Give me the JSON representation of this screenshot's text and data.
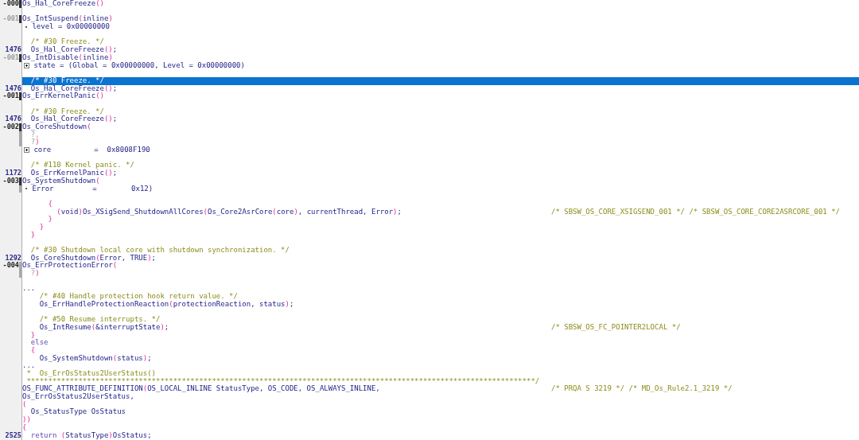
{
  "editor": {
    "lines": [
      {
        "gutter": {
          "text": "-000",
          "color": "#202020"
        },
        "marker": {
          "color": "#303030"
        },
        "selected": false,
        "segs": [
          {
            "kind": "code",
            "text": "Os_Hal_CoreFreeze"
          },
          {
            "kind": "paren",
            "text": "()"
          }
        ]
      },
      {
        "selected": false
      },
      {
        "gutter": {
          "text": "-001",
          "color": "#9a9a9a"
        },
        "marker": {
          "color": "#303030"
        },
        "selected": false,
        "segs": [
          {
            "kind": "code",
            "text": "Os_IntSuspend"
          },
          {
            "kind": "paren",
            "text": "("
          },
          {
            "kind": "code",
            "text": "inline"
          },
          {
            "kind": "paren",
            "text": ")"
          }
        ]
      },
      {
        "selected": false,
        "segs": [
          {
            "kind": "dot"
          },
          {
            "kind": "code",
            "text": " level = 0x00000000"
          }
        ]
      },
      {
        "selected": false
      },
      {
        "selected": false,
        "segs": [
          {
            "kind": "comment",
            "text": "  /* #30 Freeze. */"
          }
        ]
      },
      {
        "gutter": {
          "text": "1476",
          "color": "#2a2a8a"
        },
        "selected": false,
        "segs": [
          {
            "kind": "code",
            "text": "  Os_Hal_CoreFreeze"
          },
          {
            "kind": "paren",
            "text": "()"
          },
          {
            "kind": "code",
            "text": ";"
          }
        ]
      },
      {
        "gutter": {
          "text": "-001",
          "color": "#9a9a9a"
        },
        "marker": {
          "color": "#303030"
        },
        "selected": false,
        "segs": [
          {
            "kind": "code",
            "text": "Os_IntDisable"
          },
          {
            "kind": "paren",
            "text": "("
          },
          {
            "kind": "code",
            "text": "inline"
          },
          {
            "kind": "paren",
            "text": ")"
          }
        ]
      },
      {
        "selected": false,
        "segs": [
          {
            "kind": "plus"
          },
          {
            "kind": "code",
            "text": " state = (Global = 0x00000000, Level = 0x00000000)"
          }
        ]
      },
      {
        "selected": false
      },
      {
        "selected": true,
        "segs": [
          {
            "kind": "comment",
            "text": "  /* #30 Freeze. */"
          }
        ]
      },
      {
        "gutter": {
          "text": "1476",
          "color": "#2a2a8a"
        },
        "selected": false,
        "segs": [
          {
            "kind": "code",
            "text": "  Os_Hal_CoreFreeze"
          },
          {
            "kind": "paren",
            "text": "()"
          },
          {
            "kind": "code",
            "text": ";"
          }
        ]
      },
      {
        "gutter": {
          "text": "-001",
          "color": "#202020"
        },
        "marker": {
          "color": "#303030"
        },
        "selected": false,
        "segs": [
          {
            "kind": "code",
            "text": "Os_ErrKernelPanic"
          },
          {
            "kind": "paren",
            "text": "()"
          }
        ]
      },
      {
        "selected": false
      },
      {
        "selected": false,
        "segs": [
          {
            "kind": "comment",
            "text": "  /* #30 Freeze. */"
          }
        ]
      },
      {
        "gutter": {
          "text": "1476",
          "color": "#2a2a8a"
        },
        "selected": false,
        "segs": [
          {
            "kind": "code",
            "text": "  Os_Hal_CoreFreeze"
          },
          {
            "kind": "paren",
            "text": "()"
          },
          {
            "kind": "code",
            "text": ";"
          }
        ]
      },
      {
        "gutter": {
          "text": "-002",
          "color": "#202020"
        },
        "marker": {
          "color": "#303030"
        },
        "selected": false,
        "segs": [
          {
            "kind": "code",
            "text": "Os_CoreShutdown"
          },
          {
            "kind": "paren",
            "text": "("
          }
        ]
      },
      {
        "marker": {
          "color": "#a8a8a8"
        },
        "selected": false,
        "segs": [
          {
            "kind": "unknown",
            "text": "  ?,"
          }
        ]
      },
      {
        "marker": {
          "color": "#a8a8a8"
        },
        "selected": false,
        "segs": [
          {
            "kind": "unknown",
            "text": "  ?"
          },
          {
            "kind": "paren",
            "text": ")"
          }
        ]
      },
      {
        "selected": false,
        "segs": [
          {
            "kind": "plus"
          },
          {
            "kind": "code",
            "text": " core          =  0x8008F190"
          }
        ]
      },
      {
        "selected": false
      },
      {
        "selected": false,
        "segs": [
          {
            "kind": "comment",
            "text": "  /* #110 Kernel panic. */"
          }
        ]
      },
      {
        "gutter": {
          "text": "1172",
          "color": "#2a2a8a"
        },
        "selected": false,
        "segs": [
          {
            "kind": "code",
            "text": "  Os_ErrKernelPanic"
          },
          {
            "kind": "paren",
            "text": "()"
          },
          {
            "kind": "code",
            "text": ";"
          }
        ]
      },
      {
        "gutter": {
          "text": "-003",
          "color": "#202020"
        },
        "marker": {
          "color": "#303030"
        },
        "selected": false,
        "segs": [
          {
            "kind": "code",
            "text": "Os_SystemShutdown"
          },
          {
            "kind": "paren",
            "text": "("
          }
        ]
      },
      {
        "marker": {
          "color": "#a8a8a8"
        },
        "selected": false,
        "segs": [
          {
            "kind": "dot"
          },
          {
            "kind": "code",
            "text": " Error         =        0x12)"
          }
        ]
      },
      {
        "selected": false
      },
      {
        "selected": false,
        "segs": [
          {
            "kind": "paren",
            "text": "      {"
          }
        ]
      },
      {
        "selected": false,
        "segs": [
          {
            "kind": "paren",
            "text": "        ("
          },
          {
            "kind": "code",
            "text": "void"
          },
          {
            "kind": "paren",
            "text": ")"
          },
          {
            "kind": "code",
            "text": "Os_XSigSend_ShutdownAllCores"
          },
          {
            "kind": "paren",
            "text": "("
          },
          {
            "kind": "code",
            "text": "Os_Core2AsrCore"
          },
          {
            "kind": "paren",
            "text": "("
          },
          {
            "kind": "code",
            "text": "core"
          },
          {
            "kind": "paren",
            "text": ")"
          },
          {
            "kind": "code",
            "text": ", currentThread, Error"
          },
          {
            "kind": "paren",
            "text": ")"
          },
          {
            "kind": "code",
            "text": ";"
          }
        ],
        "note": "/* SBSW_OS_CORE_XSIGSEND_001 */ /* SBSW_OS_CORE_CORE2ASRCORE_001 */"
      },
      {
        "selected": false,
        "segs": [
          {
            "kind": "paren",
            "text": "      }"
          }
        ]
      },
      {
        "selected": false,
        "segs": [
          {
            "kind": "paren",
            "text": "    }"
          }
        ]
      },
      {
        "selected": false,
        "segs": [
          {
            "kind": "paren",
            "text": "  }"
          }
        ]
      },
      {
        "selected": false
      },
      {
        "selected": false,
        "segs": [
          {
            "kind": "comment",
            "text": "  /* #30 Shutdown local core with shutdown synchronization. */"
          }
        ]
      },
      {
        "gutter": {
          "text": "1292",
          "color": "#2a2a8a"
        },
        "selected": false,
        "segs": [
          {
            "kind": "code",
            "text": "  Os_CoreShutdown"
          },
          {
            "kind": "paren",
            "text": "("
          },
          {
            "kind": "code",
            "text": "Error, TRUE"
          },
          {
            "kind": "paren",
            "text": ")"
          },
          {
            "kind": "code",
            "text": ";"
          }
        ]
      },
      {
        "gutter": {
          "text": "-004",
          "color": "#202020"
        },
        "marker": {
          "color": "#a8a8a8"
        },
        "selected": false,
        "segs": [
          {
            "kind": "code",
            "text": "Os_ErrProtectionError"
          },
          {
            "kind": "paren",
            "text": "("
          }
        ]
      },
      {
        "marker": {
          "color": "#a8a8a8"
        },
        "selected": false,
        "segs": [
          {
            "kind": "unknown",
            "text": "  ?"
          },
          {
            "kind": "paren",
            "text": ")"
          }
        ]
      },
      {
        "selected": false
      },
      {
        "selected": false,
        "segs": [
          {
            "kind": "code",
            "text": "..."
          }
        ]
      },
      {
        "selected": false,
        "segs": [
          {
            "kind": "comment",
            "text": "    /* #40 Handle protection hook return value. */"
          }
        ]
      },
      {
        "selected": false,
        "segs": [
          {
            "kind": "code",
            "text": "    Os_ErrHandleProtectionReaction"
          },
          {
            "kind": "paren",
            "text": "("
          },
          {
            "kind": "code",
            "text": "protectionReaction, status"
          },
          {
            "kind": "paren",
            "text": ")"
          },
          {
            "kind": "code",
            "text": ";"
          }
        ]
      },
      {
        "selected": false
      },
      {
        "selected": false,
        "segs": [
          {
            "kind": "comment",
            "text": "    /* #50 Resume interrupts. */"
          }
        ]
      },
      {
        "selected": false,
        "segs": [
          {
            "kind": "code",
            "text": "    Os_IntResume"
          },
          {
            "kind": "paren",
            "text": "("
          },
          {
            "kind": "code",
            "text": "&interruptState"
          },
          {
            "kind": "paren",
            "text": ")"
          },
          {
            "kind": "code",
            "text": ";"
          }
        ],
        "note": "/* SBSW_OS_FC_POINTER2LOCAL */"
      },
      {
        "selected": false,
        "segs": [
          {
            "kind": "paren",
            "text": "  }"
          }
        ]
      },
      {
        "selected": false,
        "segs": [
          {
            "kind": "keyword",
            "text": "  else"
          }
        ]
      },
      {
        "selected": false,
        "segs": [
          {
            "kind": "paren",
            "text": "  {"
          }
        ]
      },
      {
        "selected": false,
        "segs": [
          {
            "kind": "code",
            "text": "    Os_SystemShutdown"
          },
          {
            "kind": "paren",
            "text": "("
          },
          {
            "kind": "code",
            "text": "status"
          },
          {
            "kind": "paren",
            "text": ")"
          },
          {
            "kind": "code",
            "text": ";"
          }
        ]
      },
      {
        "selected": false,
        "segs": [
          {
            "kind": "code",
            "text": "..."
          }
        ]
      },
      {
        "selected": false,
        "segs": [
          {
            "kind": "comment",
            "text": " *  Os_ErrOsStatus2UserStatus()"
          }
        ]
      },
      {
        "selected": false,
        "segs": [
          {
            "kind": "comment",
            "text": " **********************************************************************************************************************/"
          }
        ]
      },
      {
        "selected": false,
        "segs": [
          {
            "kind": "code",
            "text": "OS_FUNC_ATTRIBUTE_DEFINITION"
          },
          {
            "kind": "paren",
            "text": "("
          },
          {
            "kind": "code",
            "text": "OS_LOCAL_INLINE StatusType, OS_CODE, OS_ALWAYS_INLINE,"
          }
        ],
        "note": "/* PRQA S 3219 */ /* MD_Os_Rule2.1_3219 */"
      },
      {
        "selected": false,
        "segs": [
          {
            "kind": "code",
            "text": "Os_ErrOsStatus2UserStatus,"
          }
        ]
      },
      {
        "selected": false,
        "segs": [
          {
            "kind": "paren",
            "text": "("
          }
        ]
      },
      {
        "selected": false,
        "segs": [
          {
            "kind": "code",
            "text": "  Os_StatusType OsStatus"
          }
        ]
      },
      {
        "selected": false,
        "segs": [
          {
            "kind": "paren",
            "text": "))"
          }
        ]
      },
      {
        "selected": false,
        "segs": [
          {
            "kind": "paren",
            "text": "{"
          }
        ]
      },
      {
        "gutter": {
          "text": "2525",
          "color": "#2a2a8a"
        },
        "selected": false,
        "segs": [
          {
            "kind": "keyword",
            "text": "  return "
          },
          {
            "kind": "paren",
            "text": "("
          },
          {
            "kind": "code",
            "text": "StatusType"
          },
          {
            "kind": "paren",
            "text": ")"
          },
          {
            "kind": "code",
            "text": "OsStatus;"
          }
        ]
      }
    ]
  }
}
